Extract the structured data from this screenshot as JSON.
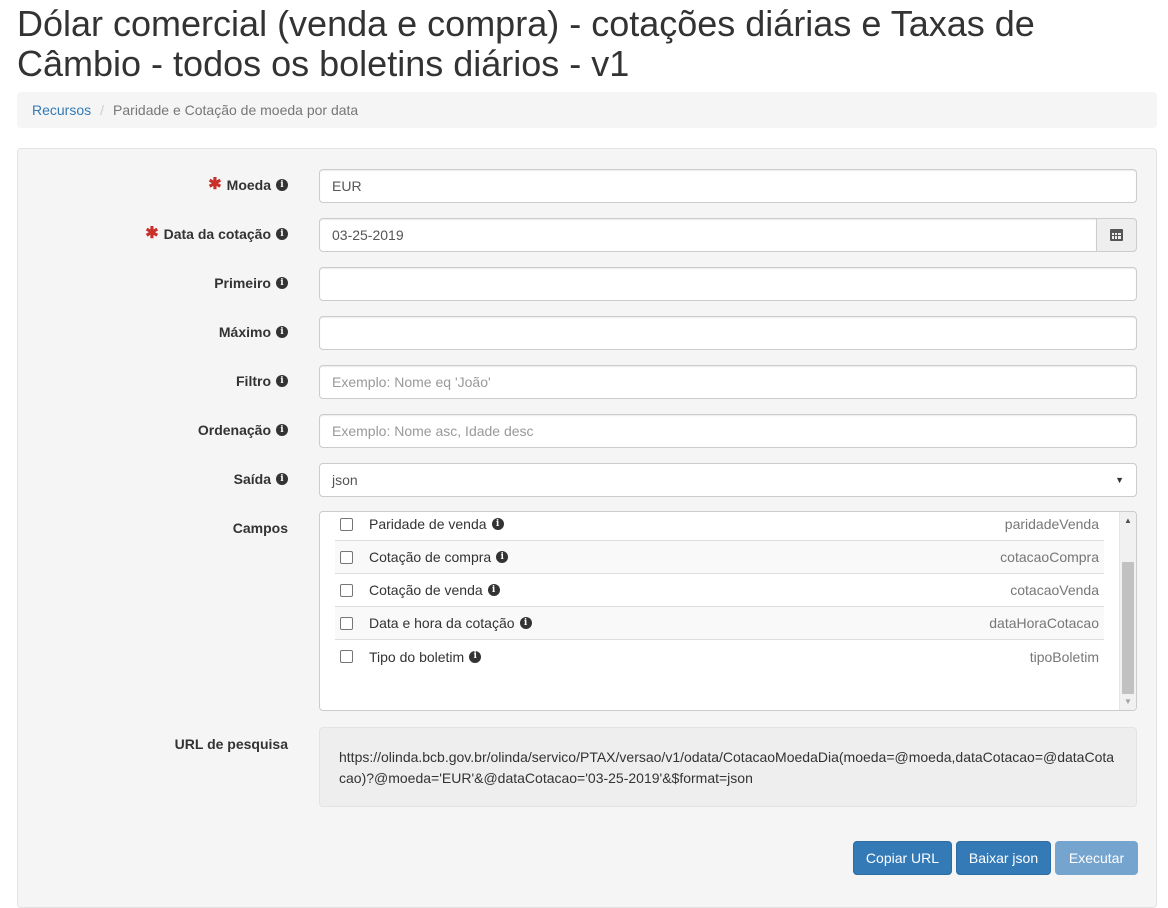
{
  "page": {
    "title": "Dólar comercial (venda e compra) - cotações diárias e Taxas de Câmbio - todos os boletins diários - v1"
  },
  "breadcrumb": {
    "link": "Recursos",
    "separator": "/",
    "active": "Paridade e Cotação de moeda por data"
  },
  "form": {
    "moeda": {
      "label": "Moeda",
      "value": "EUR",
      "required": true
    },
    "data_cotacao": {
      "label": "Data da cotação",
      "value": "03-25-2019",
      "required": true
    },
    "primeiro": {
      "label": "Primeiro",
      "value": ""
    },
    "maximo": {
      "label": "Máximo",
      "value": ""
    },
    "filtro": {
      "label": "Filtro",
      "placeholder": "Exemplo: Nome eq 'João'"
    },
    "ordenacao": {
      "label": "Ordenação",
      "placeholder": "Exemplo: Nome asc, Idade desc"
    },
    "saida": {
      "label": "Saída",
      "value": "json"
    },
    "campos": {
      "label": "Campos",
      "items": [
        {
          "label": "Paridade de venda",
          "key": "paridadeVenda",
          "checked": false
        },
        {
          "label": "Cotação de compra",
          "key": "cotacaoCompra",
          "checked": false
        },
        {
          "label": "Cotação de venda",
          "key": "cotacaoVenda",
          "checked": false
        },
        {
          "label": "Data e hora da cotação",
          "key": "dataHoraCotacao",
          "checked": false
        },
        {
          "label": "Tipo do boletim",
          "key": "tipoBoletim",
          "checked": false
        }
      ]
    },
    "url": {
      "label": "URL de pesquisa",
      "value": "https://olinda.bcb.gov.br/olinda/servico/PTAX/versao/v1/odata/CotacaoMoedaDia(moeda=@moeda,dataCotacao=@dataCotacao)?@moeda='EUR'&@dataCotacao='03-25-2019'&$format=json"
    }
  },
  "icons": {
    "required": "asterisk-icon",
    "info": "info-circle-icon",
    "calendar": "calendar-icon",
    "select": "caret-down-icon"
  },
  "buttons": {
    "copy_url": "Copiar URL",
    "download_json": "Baixar json",
    "execute": "Executar"
  },
  "colors": {
    "primary": "#337ab7",
    "required": "#c9302c",
    "disabled_button": "#6fa0cd"
  }
}
